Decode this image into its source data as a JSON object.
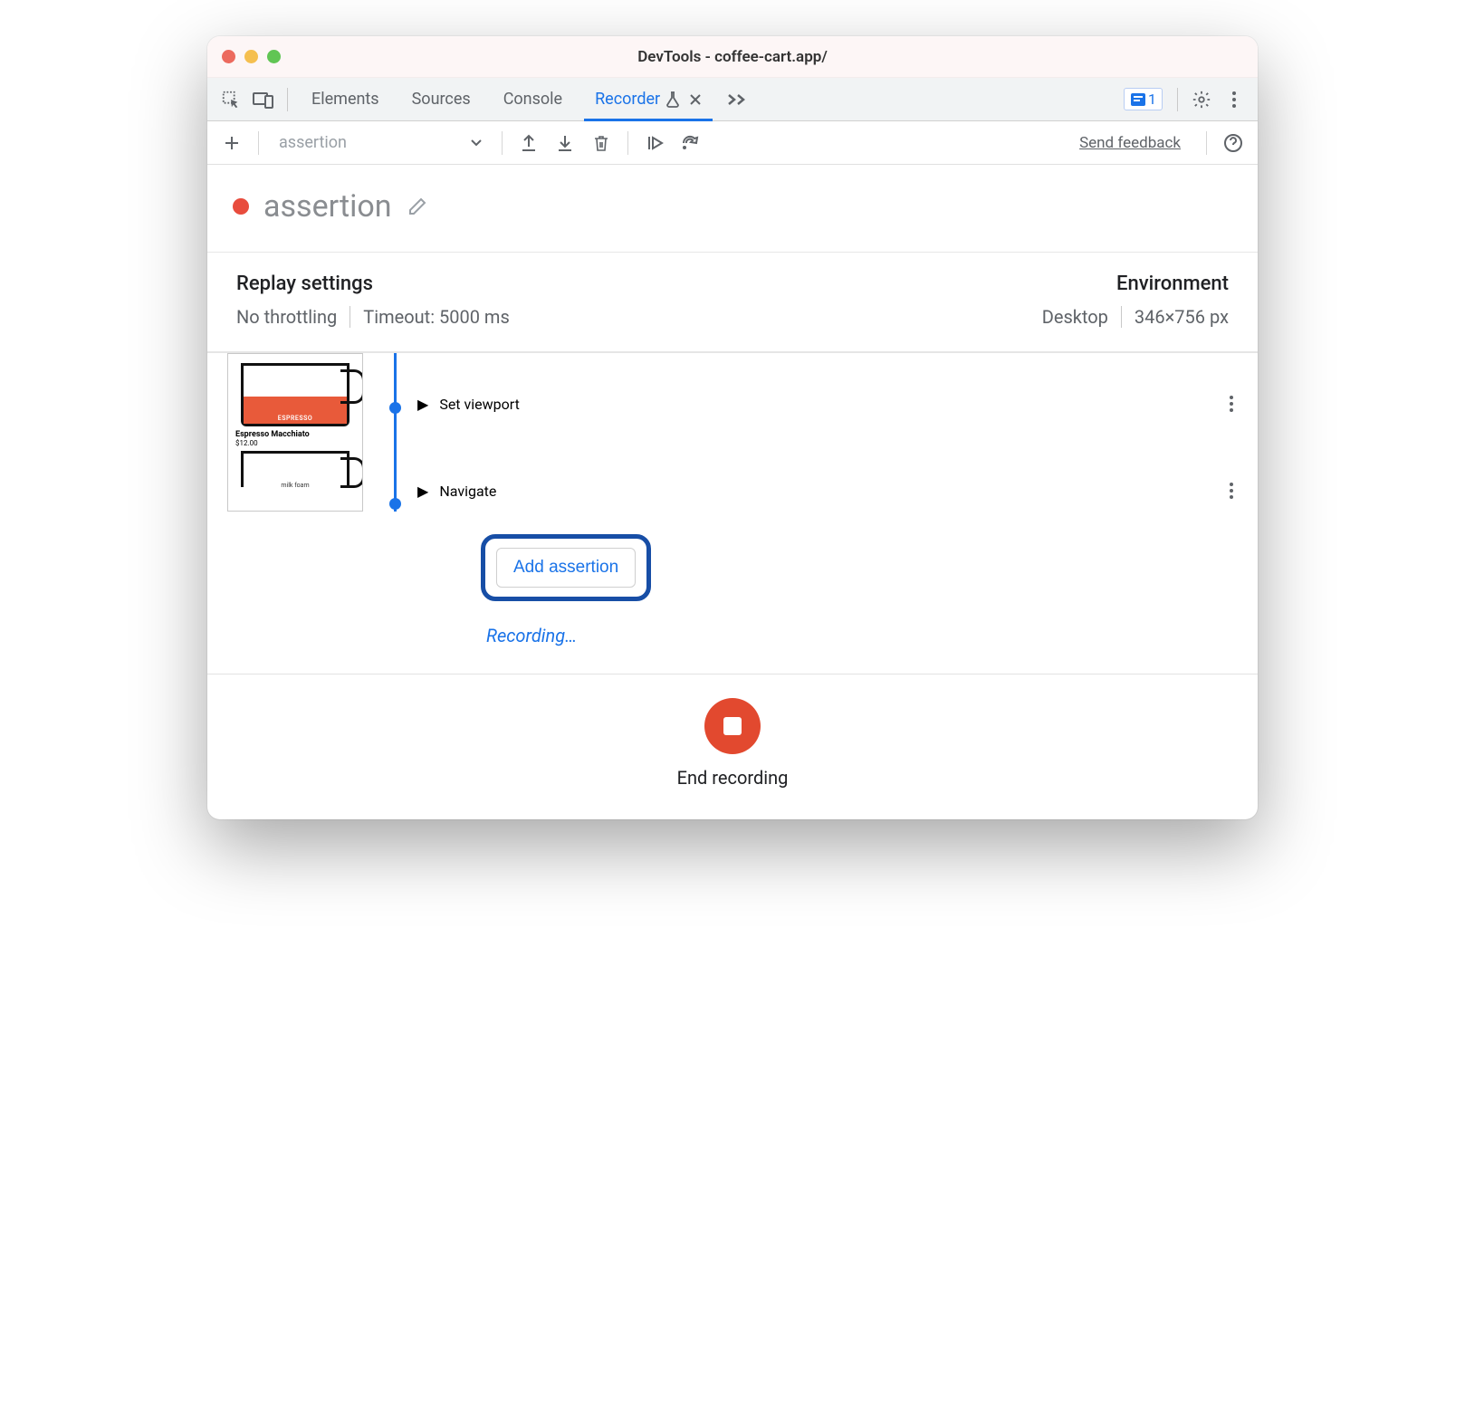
{
  "window": {
    "title": "DevTools - coffee-cart.app/"
  },
  "tabstrip": {
    "tabs": [
      {
        "label": "Elements"
      },
      {
        "label": "Sources"
      },
      {
        "label": "Console"
      },
      {
        "label": "Recorder"
      }
    ],
    "issues_count": "1"
  },
  "toolbar": {
    "recording_select": "assertion",
    "feedback": "Send feedback"
  },
  "recording": {
    "name": "assertion"
  },
  "replay_settings": {
    "heading": "Replay settings",
    "throttling": "No throttling",
    "timeout": "Timeout: 5000 ms"
  },
  "environment": {
    "heading": "Environment",
    "device": "Desktop",
    "dimensions": "346×756 px"
  },
  "thumb": {
    "product_name": "Espresso Macchiato",
    "product_price": "$12.00",
    "cup_label": "ESPRESSO",
    "cup2_label": "milk foam"
  },
  "steps": [
    {
      "label": "Set viewport"
    },
    {
      "label": "Navigate"
    }
  ],
  "add_assertion_label": "Add assertion",
  "recording_status": "Recording…",
  "footer": {
    "label": "End recording"
  }
}
